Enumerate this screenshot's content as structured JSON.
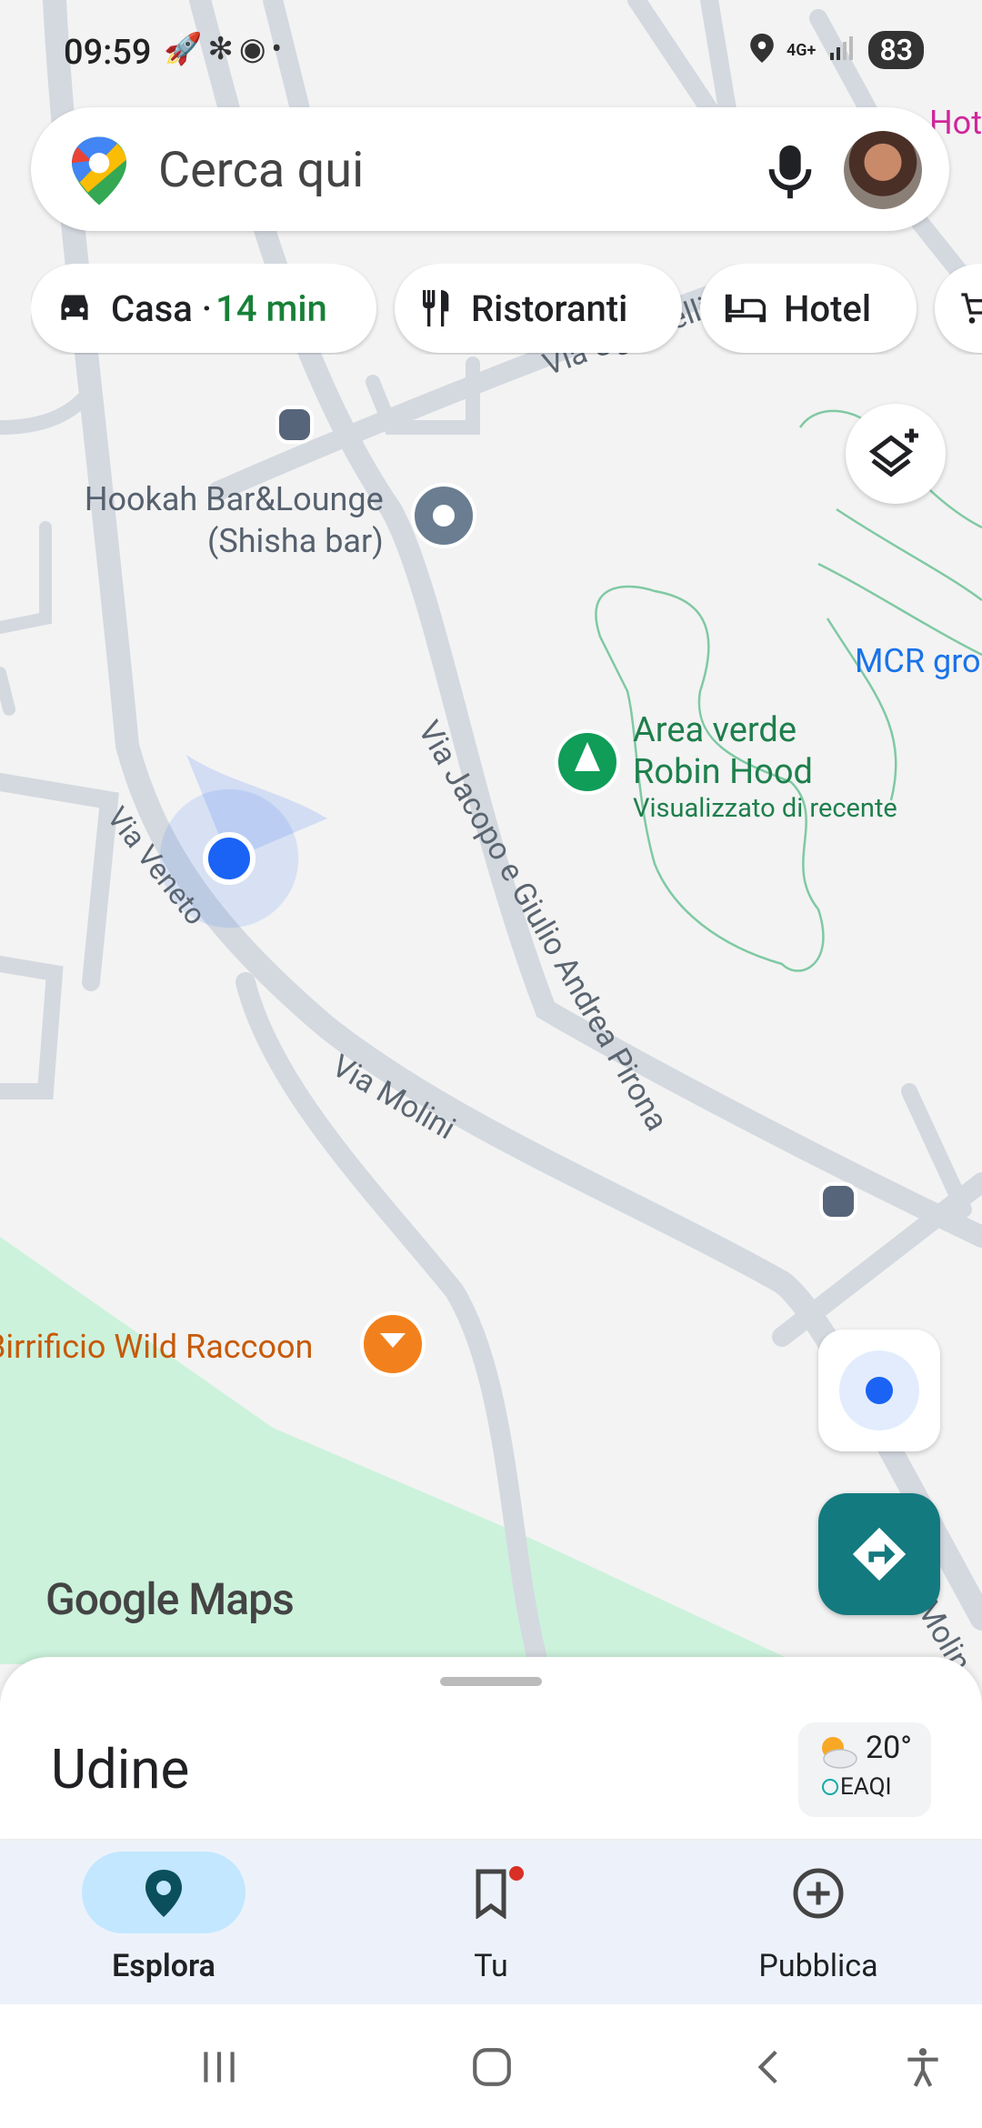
{
  "status": {
    "time": "09:59",
    "network": "4G+",
    "battery": "83"
  },
  "search": {
    "placeholder": "Cerca qui"
  },
  "chips": [
    {
      "label": "Casa · ",
      "extra": "14 min",
      "icon": "car-icon"
    },
    {
      "label": "Ristoranti",
      "icon": "fork-knife-icon"
    },
    {
      "label": "Hotel",
      "icon": "bed-icon"
    }
  ],
  "map": {
    "streets": [
      "Via Ugo Pelli",
      "Via Jacopo e Giulio Andrea Pirona",
      "Via Veneto",
      "Via Molini",
      "Molin"
    ],
    "places": {
      "hookah": "Hookah Bar&Lounge",
      "hookah_sub": "(Shisha bar)",
      "park": "Area verde",
      "park2": "Robin Hood",
      "park_sub": "Visualizzato di recente",
      "mcr": "MCR gro",
      "brewery": "Birrificio Wild Raccoon",
      "hotel": "Hot"
    },
    "watermark": "Google Maps"
  },
  "sheet": {
    "city": "Udine",
    "temperature": "20°",
    "air_quality": "EAQI"
  },
  "nav": [
    {
      "label": "Esplora",
      "icon": "pin-icon",
      "active": true
    },
    {
      "label": "Tu",
      "icon": "bookmark-icon"
    },
    {
      "label": "Pubblica",
      "icon": "add-circle-icon"
    }
  ],
  "colors": {
    "accent": "#137a7f",
    "active_pill": "#c2e7ff",
    "green": "#188038",
    "park": "#ccf2dc",
    "location": "#1a63f5"
  }
}
